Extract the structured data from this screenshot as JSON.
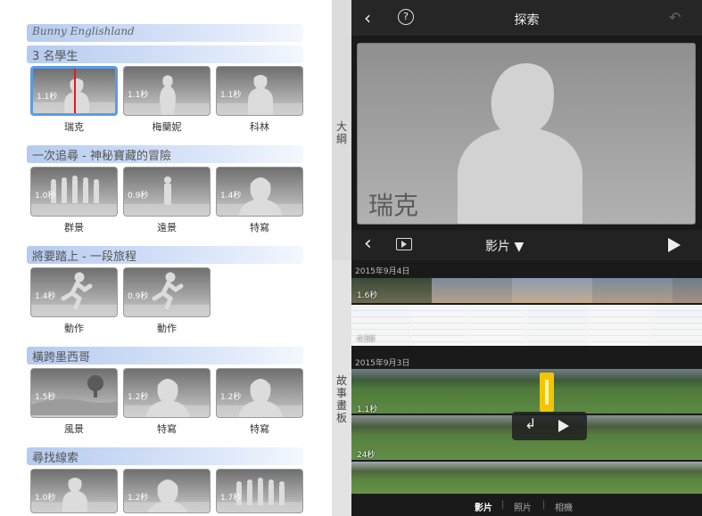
{
  "left": {
    "brand": "Bunny Englishland",
    "sections": [
      {
        "header": "3 名學生",
        "tiles": [
          {
            "dur": "1.1秒",
            "label": "瑞克",
            "icon": "person-standing-icon",
            "selected": true
          },
          {
            "dur": "1.1秒",
            "label": "梅蘭妮",
            "icon": "person-standing-icon"
          },
          {
            "dur": "1.1秒",
            "label": "科林",
            "icon": "person-standing-icon"
          }
        ]
      },
      {
        "header": "一次追尋 - 神秘寶藏的冒險",
        "tiles": [
          {
            "dur": "1.0秒",
            "label": "群景",
            "icon": "group-icon"
          },
          {
            "dur": "0.9秒",
            "label": "遠景",
            "icon": "person-far-icon"
          },
          {
            "dur": "1.4秒",
            "label": "特寫",
            "icon": "closeup-icon"
          }
        ]
      },
      {
        "header": "將要踏上 - 一段旅程",
        "tiles": [
          {
            "dur": "1.4秒",
            "label": "動作",
            "icon": "running-icon"
          },
          {
            "dur": "0.9秒",
            "label": "動作",
            "icon": "running-icon"
          }
        ]
      },
      {
        "header": "橫跨墨西哥",
        "tiles": [
          {
            "dur": "1.5秒",
            "label": "風景",
            "icon": "landscape-tree-icon"
          },
          {
            "dur": "1.2秒",
            "label": "特寫",
            "icon": "closeup-icon"
          },
          {
            "dur": "1.2秒",
            "label": "特寫",
            "icon": "closeup-icon"
          }
        ]
      },
      {
        "header": "尋找線索",
        "tiles": [
          {
            "dur": "1.0秒",
            "label": "",
            "icon": "person-standing-icon"
          },
          {
            "dur": "1.2秒",
            "label": "",
            "icon": "closeup-icon"
          },
          {
            "dur": "1.7秒",
            "label": "",
            "icon": "group-icon"
          }
        ]
      }
    ]
  },
  "sidetab": {
    "outline": "大綱",
    "storyboard": "故事畫板"
  },
  "right": {
    "title": "探索",
    "viewer_name": "瑞克",
    "media_mode": "影片 ▼",
    "groups": [
      {
        "date": "2015年9月4日",
        "durations": [
          "1.6秒",
          "4:58"
        ]
      },
      {
        "date": "2015年9月3日",
        "durations": [
          "1.1秒",
          "24秒"
        ]
      }
    ],
    "tabs": {
      "video": "影片",
      "photo": "照片",
      "camera": "相機",
      "sep": "|"
    }
  },
  "colors": {
    "accent": "#5a9be8",
    "playhead": "#e21b1b",
    "clip_marker": "#f2c500"
  }
}
